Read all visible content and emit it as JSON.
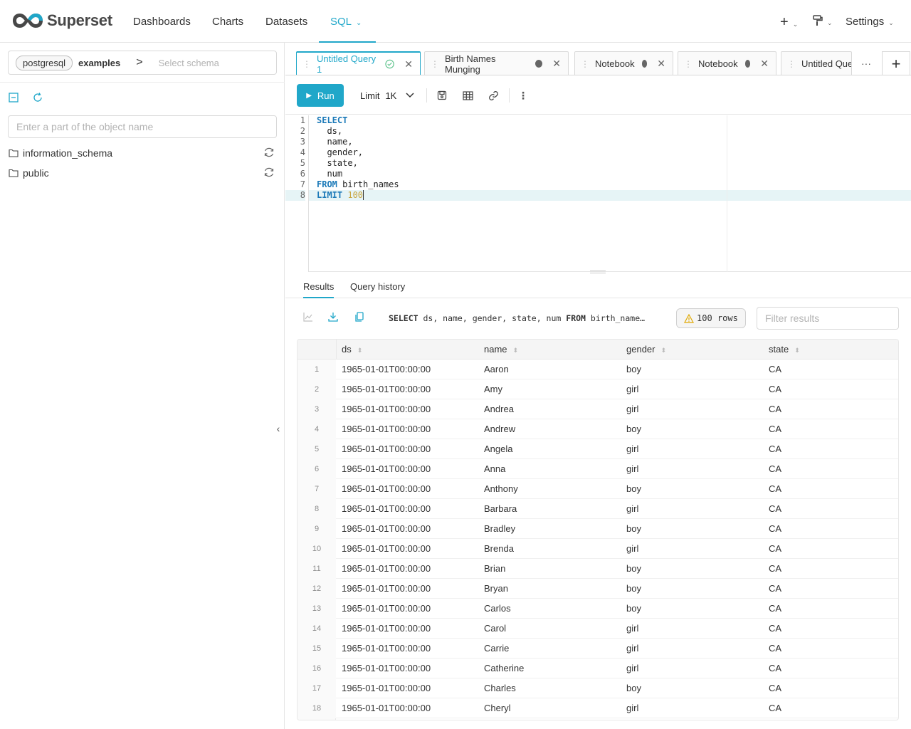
{
  "brand": {
    "name": "Superset"
  },
  "nav": {
    "items": [
      "Dashboards",
      "Charts",
      "Datasets",
      "SQL"
    ],
    "settings_label": "Settings"
  },
  "left": {
    "database": "postgresql",
    "db_name": "examples",
    "schema_placeholder": "Select schema",
    "object_placeholder": "Enter a part of the object name",
    "schemas": [
      "information_schema",
      "public"
    ]
  },
  "tabs": [
    {
      "label": "Untitled Query 1"
    },
    {
      "label": "Birth Names Munging"
    },
    {
      "label": "Notebook"
    },
    {
      "label": "Notebook"
    },
    {
      "label": "Untitled Que"
    }
  ],
  "toolbar": {
    "run_label": "Run",
    "limit_label": "Limit",
    "limit_value": "1K"
  },
  "editor": {
    "line_numbers": [
      "1",
      "2",
      "3",
      "4",
      "5",
      "6",
      "7",
      "8"
    ]
  },
  "results": {
    "tabs": [
      "Results",
      "Query history"
    ],
    "sql_preview_prefix": "SELECT",
    "sql_preview_rest": " ds, name, gender, state, num ",
    "sql_preview_from": "FROM",
    "sql_preview_tail": " birth_name…",
    "rows_label": "100 rows",
    "filter_placeholder": "Filter results",
    "columns": [
      "ds",
      "name",
      "gender",
      "state"
    ],
    "rows": [
      [
        "1",
        "1965-01-01T00:00:00",
        "Aaron",
        "boy",
        "CA"
      ],
      [
        "2",
        "1965-01-01T00:00:00",
        "Amy",
        "girl",
        "CA"
      ],
      [
        "3",
        "1965-01-01T00:00:00",
        "Andrea",
        "girl",
        "CA"
      ],
      [
        "4",
        "1965-01-01T00:00:00",
        "Andrew",
        "boy",
        "CA"
      ],
      [
        "5",
        "1965-01-01T00:00:00",
        "Angela",
        "girl",
        "CA"
      ],
      [
        "6",
        "1965-01-01T00:00:00",
        "Anna",
        "girl",
        "CA"
      ],
      [
        "7",
        "1965-01-01T00:00:00",
        "Anthony",
        "boy",
        "CA"
      ],
      [
        "8",
        "1965-01-01T00:00:00",
        "Barbara",
        "girl",
        "CA"
      ],
      [
        "9",
        "1965-01-01T00:00:00",
        "Bradley",
        "boy",
        "CA"
      ],
      [
        "10",
        "1965-01-01T00:00:00",
        "Brenda",
        "girl",
        "CA"
      ],
      [
        "11",
        "1965-01-01T00:00:00",
        "Brian",
        "boy",
        "CA"
      ],
      [
        "12",
        "1965-01-01T00:00:00",
        "Bryan",
        "boy",
        "CA"
      ],
      [
        "13",
        "1965-01-01T00:00:00",
        "Carlos",
        "boy",
        "CA"
      ],
      [
        "14",
        "1965-01-01T00:00:00",
        "Carol",
        "girl",
        "CA"
      ],
      [
        "15",
        "1965-01-01T00:00:00",
        "Carrie",
        "girl",
        "CA"
      ],
      [
        "16",
        "1965-01-01T00:00:00",
        "Catherine",
        "girl",
        "CA"
      ],
      [
        "17",
        "1965-01-01T00:00:00",
        "Charles",
        "boy",
        "CA"
      ],
      [
        "18",
        "1965-01-01T00:00:00",
        "Cheryl",
        "girl",
        "CA"
      ]
    ]
  },
  "colors": {
    "accent": "#20a7c9"
  }
}
